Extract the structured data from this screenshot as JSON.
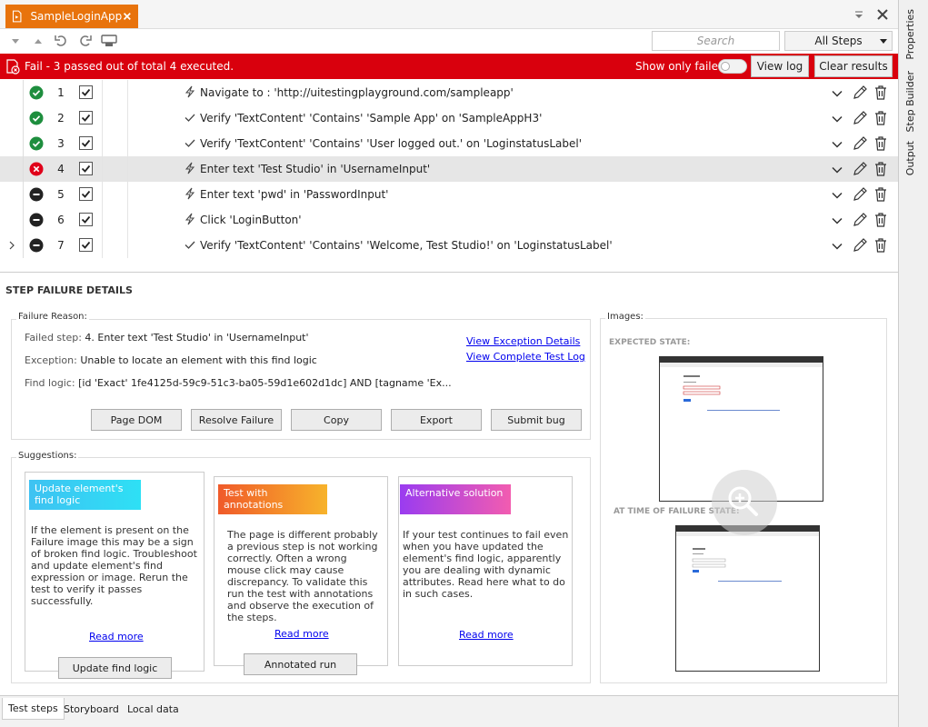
{
  "window": {
    "tab_title": "SampleLoginApp",
    "close_label": "×"
  },
  "toolbar": {
    "search_placeholder": "Search",
    "filter_selected": "All Steps"
  },
  "result_bar": {
    "status_text": "Fail - 3 passed out of total 4 executed.",
    "show_only_failed_label": "Show only failed",
    "show_only_failed_on": false,
    "view_log_label": "View log",
    "clear_results_label": "Clear results",
    "color": "#d9000d"
  },
  "steps": [
    {
      "num": "1",
      "status": "passed",
      "type": "action",
      "text": "Navigate to : 'http://uitestingplayground.com/sampleapp'"
    },
    {
      "num": "2",
      "status": "passed",
      "type": "verify",
      "text": "Verify 'TextContent' 'Contains' 'Sample App' on 'SampleAppH3'"
    },
    {
      "num": "3",
      "status": "passed",
      "type": "verify",
      "text": "Verify 'TextContent' 'Contains' 'User logged out.' on 'LoginstatusLabel'"
    },
    {
      "num": "4",
      "status": "failed",
      "type": "action",
      "text": "Enter text 'Test Studio' in 'UsernameInput'"
    },
    {
      "num": "5",
      "status": "not-run",
      "type": "action",
      "text": "Enter text 'pwd' in 'PasswordInput'"
    },
    {
      "num": "6",
      "status": "not-run",
      "type": "action",
      "text": "Click 'LoginButton'"
    },
    {
      "num": "7",
      "status": "not-run",
      "type": "verify",
      "text": "Verify 'TextContent' 'Contains' 'Welcome, Test Studio!' on 'LoginstatusLabel'"
    }
  ],
  "details": {
    "heading": "STEP FAILURE DETAILS",
    "failure_reason_label": "Failure Reason:",
    "failed_step_label": "Failed step:",
    "failed_step_value": "4. Enter text 'Test Studio' in 'UsernameInput'",
    "exception_label": "Exception:",
    "exception_value": "Unable to locate an element with this find logic",
    "find_logic_label": "Find logic:",
    "find_logic_value": "[id 'Exact' 1fe4125d-59c9-51c3-ba05-59d1e602d1dc] AND [tagname 'Ex...",
    "view_exception_link": "View Exception Details",
    "view_log_link": "View Complete Test Log",
    "buttons": {
      "page_dom": "Page DOM",
      "resolve_failure": "Resolve Failure",
      "copy": "Copy",
      "export": "Export",
      "submit_bug": "Submit bug"
    },
    "suggestions_label": "Suggestions:",
    "suggestions": [
      {
        "badge": "Update element's find logic",
        "body": "If the element is present on the Failure image this may be a sign of broken find logic. Troubleshoot and update element's find expression or image. Rerun the test to verify it passes successfully.",
        "read_more": "Read more",
        "action": "Update find logic"
      },
      {
        "badge": "Test with annotations",
        "body": "The page is different probably a previous step is not working correctly. Often a wrong mouse click may cause discrepancy. To validate this run the test with annotations and observe the execution of the steps.",
        "read_more": "Read more",
        "action": "Annotated run"
      },
      {
        "badge": "Alternative solution",
        "body": "If your test continues to fail even when you have updated the element's find logic, apparently you are dealing with dynamic attributes. Read here what to do in such cases.",
        "read_more": "Read more"
      }
    ],
    "images_label": "Images:",
    "expected_state_label": "EXPECTED STATE:",
    "failure_state_label": "AT TIME OF FAILURE STATE:"
  },
  "bottom_tabs": [
    "Test steps",
    "Storyboard",
    "Local data"
  ],
  "side_tabs": [
    "Properties",
    "Step Builder",
    "Output"
  ],
  "colors": {
    "accent": "#e8730c",
    "passed": "#1e8e3e",
    "failed": "#e0001a",
    "not_run": "#222222",
    "link": "#0000ee"
  }
}
